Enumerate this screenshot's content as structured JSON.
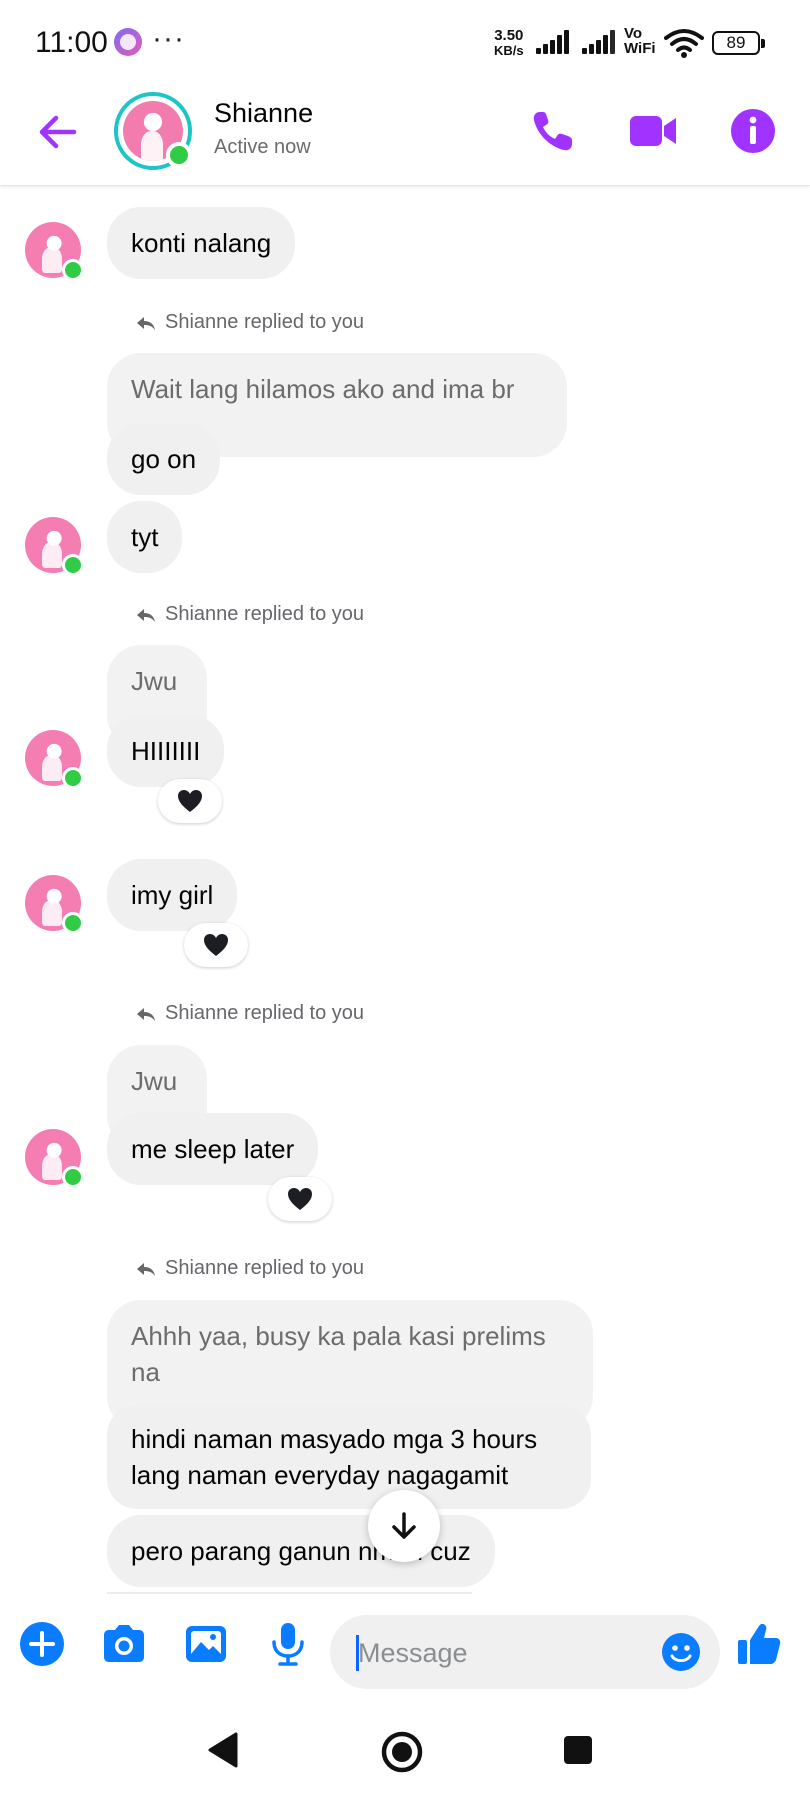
{
  "status_bar": {
    "time": "11:00",
    "more": "···",
    "net_speed_value": "3.50",
    "net_speed_unit": "KB/s",
    "vowifi_top": "Vo",
    "vowifi_bottom": "WiFi",
    "battery": "89"
  },
  "header": {
    "contact_name": "Shianne",
    "contact_status": "Active now",
    "icons": [
      "back-arrow-icon",
      "phone-icon",
      "video-camera-icon",
      "info-icon"
    ],
    "accent_color": "#a033ff"
  },
  "replied_label": "Shianne replied to you",
  "messages": [
    {
      "text": "konti nalang"
    },
    {
      "quote": "Wait lang hilamos ako and ima br",
      "text": "go on"
    },
    {
      "text": "tyt"
    },
    {
      "quote": "Jwu",
      "text": "HIIIIIII",
      "reaction": "black-heart"
    },
    {
      "text": "imy girl",
      "reaction": "black-heart"
    },
    {
      "quote": "Jwu",
      "text": "me sleep later",
      "reaction": "black-heart"
    },
    {
      "quote_line1": "Ahhh yaa, busy ka pala kasi prelims",
      "quote_line2": "na",
      "text_line1": "hindi naman masyado mga 3 hours",
      "text_line2": "lang naman everyday nagagamit"
    },
    {
      "text": "pero parang ganun nman cuz"
    }
  ],
  "composer": {
    "placeholder": "Message",
    "icons": [
      "plus-icon",
      "camera-icon",
      "gallery-icon",
      "microphone-icon",
      "emoji-icon",
      "thumbs-up-icon"
    ],
    "icon_color": "#0a7cff"
  },
  "nav_bar": {
    "icons": [
      "back-triangle-icon",
      "home-circle-icon",
      "recents-square-icon"
    ]
  }
}
